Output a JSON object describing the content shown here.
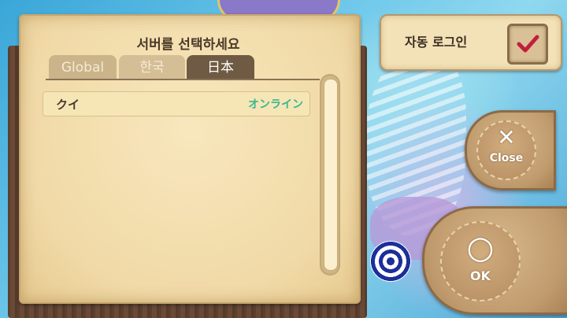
{
  "server_select": {
    "title": "서버를 선택하세요",
    "tabs": [
      {
        "label": "Global",
        "selected": false
      },
      {
        "label": "한국",
        "selected": false
      },
      {
        "label": "日本",
        "selected": true
      }
    ],
    "servers": [
      {
        "name": "クイ",
        "status": "オンライン",
        "status_color": "#3bb690"
      }
    ]
  },
  "auto_login": {
    "label": "자동 로그인",
    "checked": true,
    "check_color": "#c0203a"
  },
  "buttons": {
    "close": {
      "symbol": "✕",
      "label": "Close"
    },
    "ok": {
      "symbol": "○",
      "label": "OK"
    }
  },
  "icons": {
    "checkbox": "check-mark-icon",
    "close": "x-icon",
    "ok": "circle-icon"
  }
}
